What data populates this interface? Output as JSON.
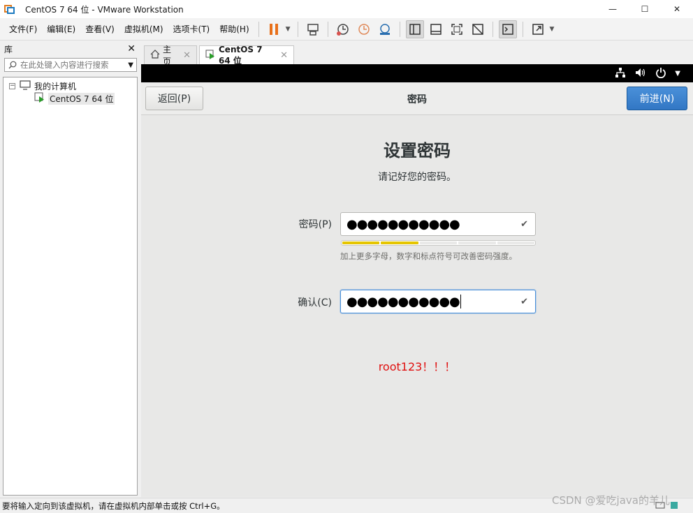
{
  "window": {
    "title": "CentOS 7 64 位 - VMware Workstation",
    "controls": {
      "minimize": "—",
      "maximize": "☐",
      "close": "✕"
    }
  },
  "menu": {
    "items": [
      "文件(F)",
      "编辑(E)",
      "查看(V)",
      "虚拟机(M)",
      "选项卡(T)",
      "帮助(H)"
    ]
  },
  "toolbar": {
    "icons": [
      "pause-icon",
      "send-ctrl-alt-del-icon",
      "snapshot-icon",
      "revert-snapshot-icon",
      "snapshot-manager-icon",
      "library-view-icon",
      "thumbnail-view-icon",
      "fullscreen-icon",
      "unity-icon",
      "console-icon",
      "stretch-icon"
    ]
  },
  "library": {
    "title": "库",
    "close": "✕",
    "search_placeholder": "在此处键入内容进行搜索",
    "tree": {
      "root_label": "我的计算机",
      "root_toggle": "−",
      "vm_label": "CentOS 7 64 位"
    }
  },
  "tabs": [
    {
      "label": "主页",
      "close": "✕"
    },
    {
      "label": "CentOS 7 64 位",
      "close": "✕"
    }
  ],
  "installer": {
    "back_button": "返回(P)",
    "header_title": "密码",
    "next_button": "前进(N)",
    "heading": "设置密码",
    "subheading": "请记好您的密码。",
    "password_label": "密码(P)",
    "password_value": "●●●●●●●●●●●",
    "confirm_label": "确认(C)",
    "confirm_value": "●●●●●●●●●●●",
    "check_mark": "✔",
    "strength_segments_filled": 2,
    "strength_segments_total": 5,
    "strength_hint": "加上更多字母，数字和标点符号可改善密码强度。",
    "annotation": "root123！！！",
    "colors": {
      "accent": "#4a90d9",
      "strength": "#e5c500",
      "annotation": "#e01010"
    }
  },
  "statusbar": {
    "text": "要将输入定向到该虚拟机，请在虚拟机内部单击或按 Ctrl+G。"
  },
  "watermark": "CSDN @爱吃java的羊儿"
}
